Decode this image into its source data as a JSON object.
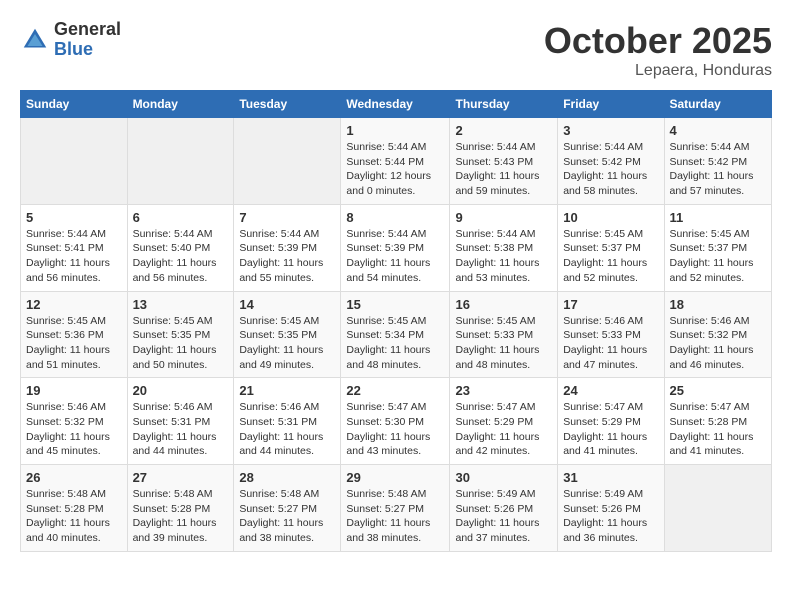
{
  "header": {
    "logo_general": "General",
    "logo_blue": "Blue",
    "month_title": "October 2025",
    "subtitle": "Lepaera, Honduras"
  },
  "days_of_week": [
    "Sunday",
    "Monday",
    "Tuesday",
    "Wednesday",
    "Thursday",
    "Friday",
    "Saturday"
  ],
  "weeks": [
    [
      {
        "day": "",
        "info": ""
      },
      {
        "day": "",
        "info": ""
      },
      {
        "day": "",
        "info": ""
      },
      {
        "day": "1",
        "info": "Sunrise: 5:44 AM\nSunset: 5:44 PM\nDaylight: 12 hours\nand 0 minutes."
      },
      {
        "day": "2",
        "info": "Sunrise: 5:44 AM\nSunset: 5:43 PM\nDaylight: 11 hours\nand 59 minutes."
      },
      {
        "day": "3",
        "info": "Sunrise: 5:44 AM\nSunset: 5:42 PM\nDaylight: 11 hours\nand 58 minutes."
      },
      {
        "day": "4",
        "info": "Sunrise: 5:44 AM\nSunset: 5:42 PM\nDaylight: 11 hours\nand 57 minutes."
      }
    ],
    [
      {
        "day": "5",
        "info": "Sunrise: 5:44 AM\nSunset: 5:41 PM\nDaylight: 11 hours\nand 56 minutes."
      },
      {
        "day": "6",
        "info": "Sunrise: 5:44 AM\nSunset: 5:40 PM\nDaylight: 11 hours\nand 56 minutes."
      },
      {
        "day": "7",
        "info": "Sunrise: 5:44 AM\nSunset: 5:39 PM\nDaylight: 11 hours\nand 55 minutes."
      },
      {
        "day": "8",
        "info": "Sunrise: 5:44 AM\nSunset: 5:39 PM\nDaylight: 11 hours\nand 54 minutes."
      },
      {
        "day": "9",
        "info": "Sunrise: 5:44 AM\nSunset: 5:38 PM\nDaylight: 11 hours\nand 53 minutes."
      },
      {
        "day": "10",
        "info": "Sunrise: 5:45 AM\nSunset: 5:37 PM\nDaylight: 11 hours\nand 52 minutes."
      },
      {
        "day": "11",
        "info": "Sunrise: 5:45 AM\nSunset: 5:37 PM\nDaylight: 11 hours\nand 52 minutes."
      }
    ],
    [
      {
        "day": "12",
        "info": "Sunrise: 5:45 AM\nSunset: 5:36 PM\nDaylight: 11 hours\nand 51 minutes."
      },
      {
        "day": "13",
        "info": "Sunrise: 5:45 AM\nSunset: 5:35 PM\nDaylight: 11 hours\nand 50 minutes."
      },
      {
        "day": "14",
        "info": "Sunrise: 5:45 AM\nSunset: 5:35 PM\nDaylight: 11 hours\nand 49 minutes."
      },
      {
        "day": "15",
        "info": "Sunrise: 5:45 AM\nSunset: 5:34 PM\nDaylight: 11 hours\nand 48 minutes."
      },
      {
        "day": "16",
        "info": "Sunrise: 5:45 AM\nSunset: 5:33 PM\nDaylight: 11 hours\nand 48 minutes."
      },
      {
        "day": "17",
        "info": "Sunrise: 5:46 AM\nSunset: 5:33 PM\nDaylight: 11 hours\nand 47 minutes."
      },
      {
        "day": "18",
        "info": "Sunrise: 5:46 AM\nSunset: 5:32 PM\nDaylight: 11 hours\nand 46 minutes."
      }
    ],
    [
      {
        "day": "19",
        "info": "Sunrise: 5:46 AM\nSunset: 5:32 PM\nDaylight: 11 hours\nand 45 minutes."
      },
      {
        "day": "20",
        "info": "Sunrise: 5:46 AM\nSunset: 5:31 PM\nDaylight: 11 hours\nand 44 minutes."
      },
      {
        "day": "21",
        "info": "Sunrise: 5:46 AM\nSunset: 5:31 PM\nDaylight: 11 hours\nand 44 minutes."
      },
      {
        "day": "22",
        "info": "Sunrise: 5:47 AM\nSunset: 5:30 PM\nDaylight: 11 hours\nand 43 minutes."
      },
      {
        "day": "23",
        "info": "Sunrise: 5:47 AM\nSunset: 5:29 PM\nDaylight: 11 hours\nand 42 minutes."
      },
      {
        "day": "24",
        "info": "Sunrise: 5:47 AM\nSunset: 5:29 PM\nDaylight: 11 hours\nand 41 minutes."
      },
      {
        "day": "25",
        "info": "Sunrise: 5:47 AM\nSunset: 5:28 PM\nDaylight: 11 hours\nand 41 minutes."
      }
    ],
    [
      {
        "day": "26",
        "info": "Sunrise: 5:48 AM\nSunset: 5:28 PM\nDaylight: 11 hours\nand 40 minutes."
      },
      {
        "day": "27",
        "info": "Sunrise: 5:48 AM\nSunset: 5:28 PM\nDaylight: 11 hours\nand 39 minutes."
      },
      {
        "day": "28",
        "info": "Sunrise: 5:48 AM\nSunset: 5:27 PM\nDaylight: 11 hours\nand 38 minutes."
      },
      {
        "day": "29",
        "info": "Sunrise: 5:48 AM\nSunset: 5:27 PM\nDaylight: 11 hours\nand 38 minutes."
      },
      {
        "day": "30",
        "info": "Sunrise: 5:49 AM\nSunset: 5:26 PM\nDaylight: 11 hours\nand 37 minutes."
      },
      {
        "day": "31",
        "info": "Sunrise: 5:49 AM\nSunset: 5:26 PM\nDaylight: 11 hours\nand 36 minutes."
      },
      {
        "day": "",
        "info": ""
      }
    ]
  ]
}
